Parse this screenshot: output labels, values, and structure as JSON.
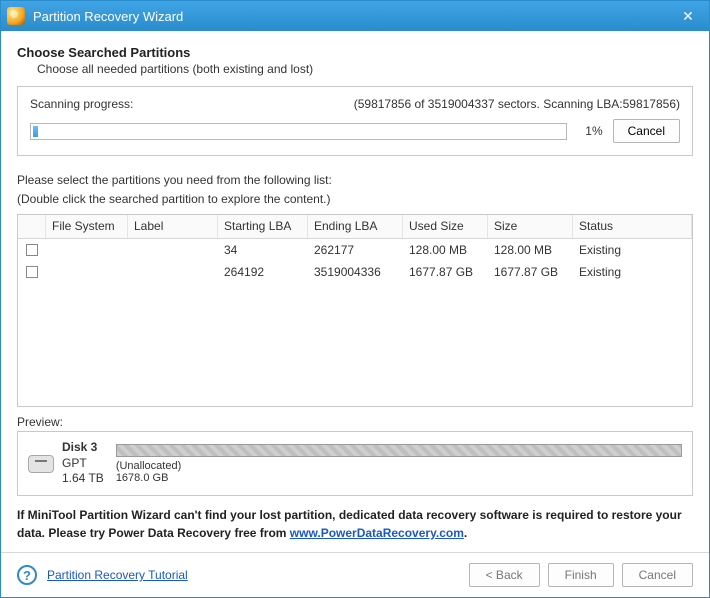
{
  "window": {
    "title": "Partition Recovery Wizard"
  },
  "header": {
    "heading": "Choose Searched Partitions",
    "subheading": "Choose all needed partitions (both existing and lost)"
  },
  "progress": {
    "label": "Scanning progress:",
    "detail": "(59817856 of 3519004337 sectors. Scanning LBA:59817856)",
    "percent_text": "1%",
    "percent_value": 1,
    "cancel_label": "Cancel"
  },
  "instructions": {
    "line1": "Please select the partitions you need from the following list:",
    "line2": "(Double click the searched partition to explore the content.)"
  },
  "table": {
    "columns": {
      "filesystem": "File System",
      "label": "Label",
      "starting_lba": "Starting LBA",
      "ending_lba": "Ending LBA",
      "used_size": "Used Size",
      "size": "Size",
      "status": "Status"
    },
    "rows": [
      {
        "filesystem": "",
        "label": "",
        "starting_lba": "34",
        "ending_lba": "262177",
        "used_size": "128.00 MB",
        "size": "128.00 MB",
        "status": "Existing"
      },
      {
        "filesystem": "",
        "label": "",
        "starting_lba": "264192",
        "ending_lba": "3519004336",
        "used_size": "1677.87 GB",
        "size": "1677.87 GB",
        "status": "Existing"
      }
    ]
  },
  "preview": {
    "label": "Preview:",
    "disk_name": "Disk 3",
    "disk_scheme": "GPT",
    "disk_capacity": "1.64 TB",
    "region_label": "(Unallocated)",
    "region_size": "1678.0 GB"
  },
  "note": {
    "text_before_link": "If MiniTool Partition Wizard can't find your lost partition, dedicated data recovery software is required to restore your data. Please try Power Data Recovery free from ",
    "link_text": "www.PowerDataRecovery.com",
    "text_after_link": "."
  },
  "footer": {
    "tutorial_link": "Partition Recovery Tutorial",
    "back_label": "< Back",
    "finish_label": "Finish",
    "cancel_label": "Cancel"
  }
}
